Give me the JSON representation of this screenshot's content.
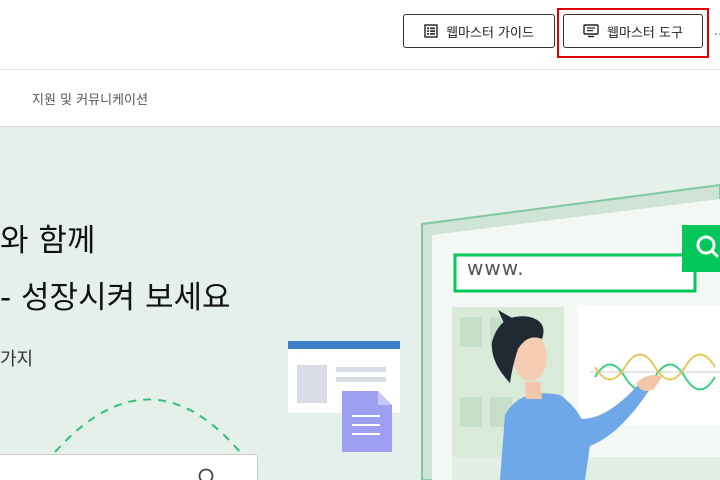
{
  "header": {
    "guide_button": "웹마스터 가이드",
    "tools_button": "웹마스터 도구",
    "edge_text": "…",
    "guide_icon": "list-doc-icon",
    "tools_icon": "monitor-icon"
  },
  "nav": {
    "support_label": "지원 및 커뮤니케이션"
  },
  "hero": {
    "line1": "와 함께",
    "line2": "- 성장시켜 보세요",
    "subtitle": "가지",
    "search_placeholder": ""
  },
  "illustration": {
    "url_text": "www."
  },
  "colors": {
    "hero_bg": "#e6f0ea",
    "brand_green": "#03c75a",
    "highlight_red": "#e00000",
    "doc_blue": "#3d7ec9",
    "doc_purple": "#9d9ff0"
  }
}
